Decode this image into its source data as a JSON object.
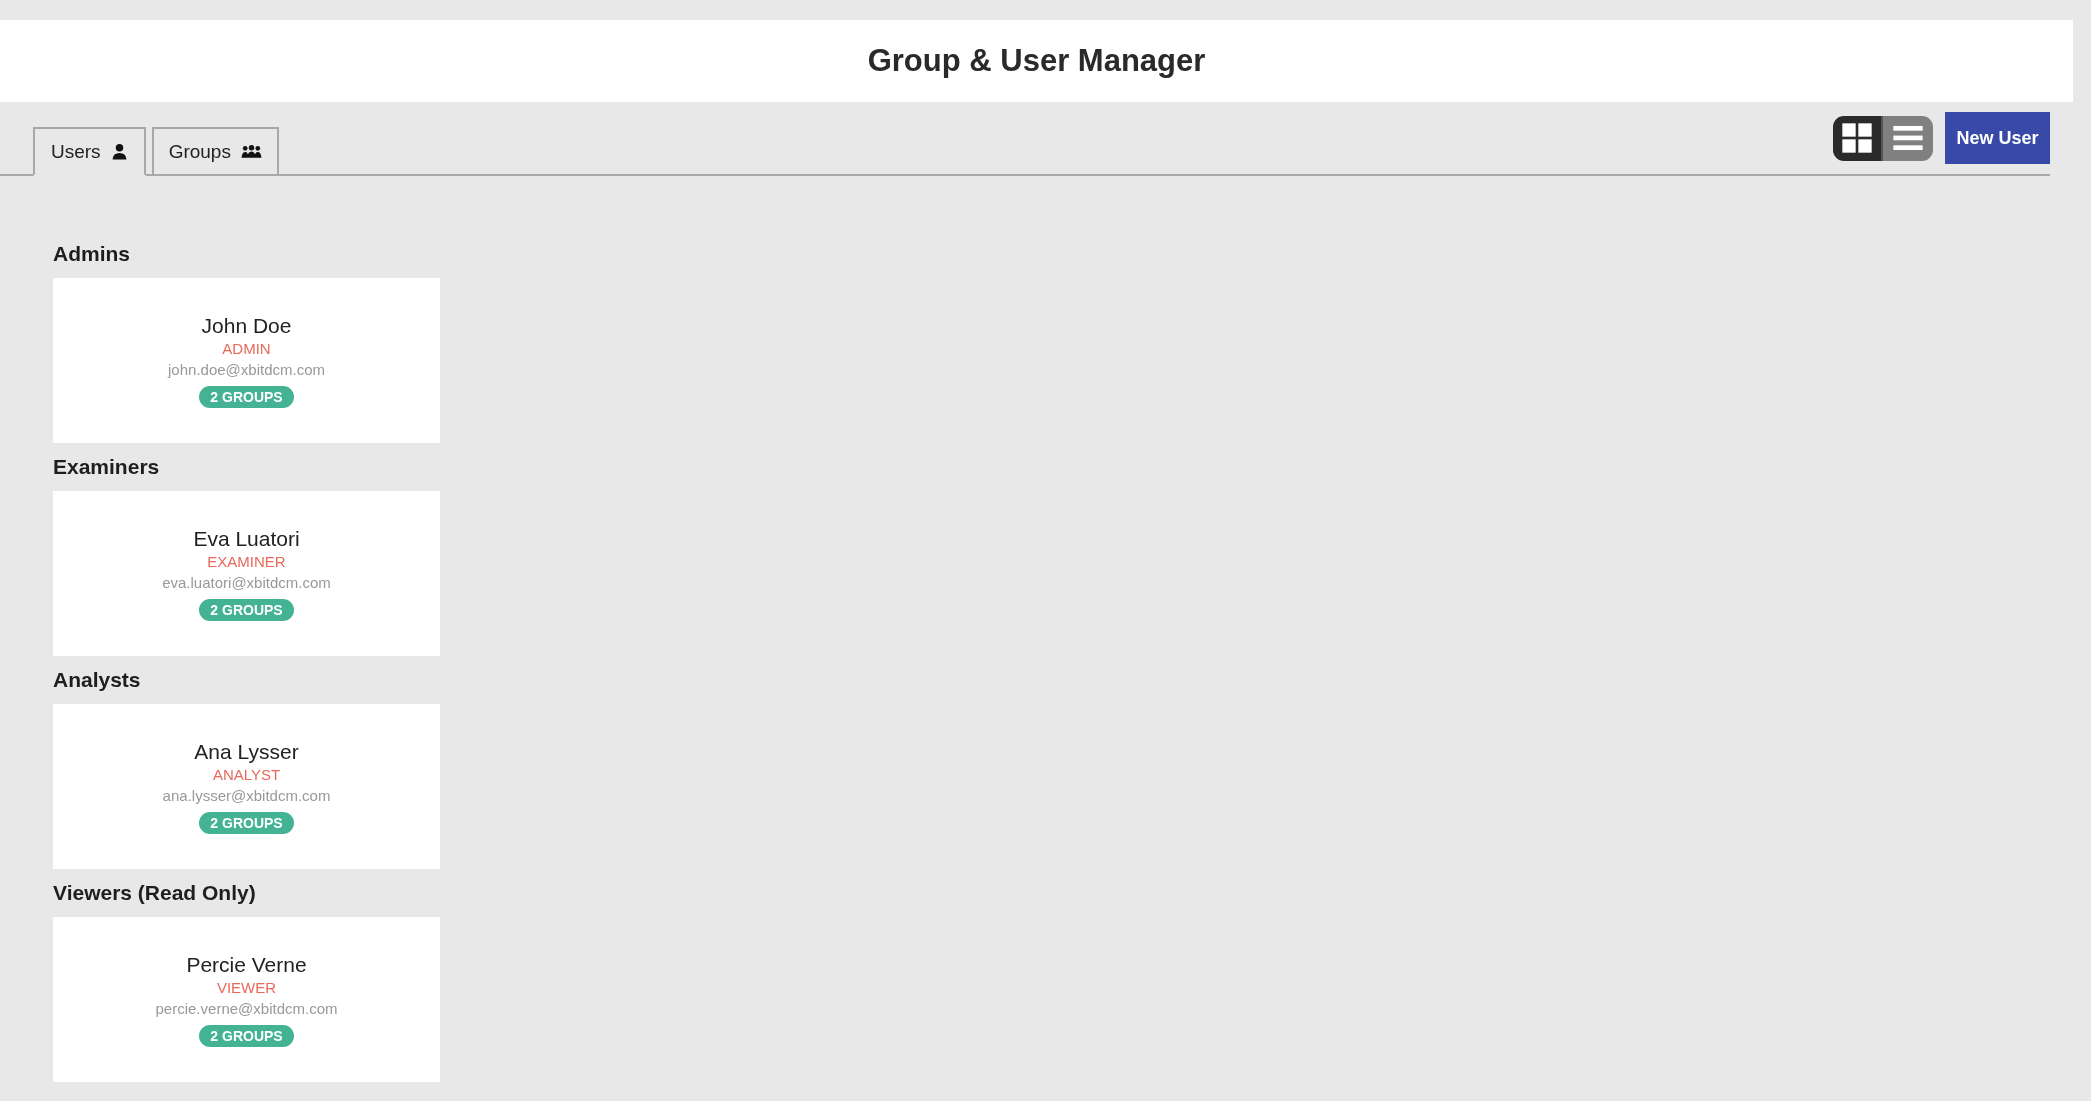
{
  "header": {
    "title": "Group & User Manager"
  },
  "tabs": [
    {
      "label": "Users",
      "kind": "user",
      "selected": true
    },
    {
      "label": "Groups",
      "kind": "group",
      "selected": false
    }
  ],
  "view_toggle": [
    {
      "kind": "grid",
      "selected": true
    },
    {
      "kind": "list",
      "selected": false
    }
  ],
  "new_button": "New User",
  "sections": [
    {
      "title": "Admins",
      "users": [
        {
          "name": "John Doe",
          "role": "ADMIN",
          "email": "john.doe@xbitdcm.com",
          "groups": "2 GROUPS"
        }
      ]
    },
    {
      "title": "Examiners",
      "users": [
        {
          "name": "Eva Luatori",
          "role": "EXAMINER",
          "email": "eva.luatori@xbitdcm.com",
          "groups": "2 GROUPS"
        }
      ]
    },
    {
      "title": "Analysts",
      "users": [
        {
          "name": "Ana Lysser",
          "role": "ANALYST",
          "email": "ana.lysser@xbitdcm.com",
          "groups": "2 GROUPS"
        }
      ]
    },
    {
      "title": "Viewers (Read Only)",
      "users": [
        {
          "name": "Percie Verne",
          "role": "VIEWER",
          "email": "percie.verne@xbitdcm.com",
          "groups": "2 GROUPS"
        }
      ]
    }
  ]
}
